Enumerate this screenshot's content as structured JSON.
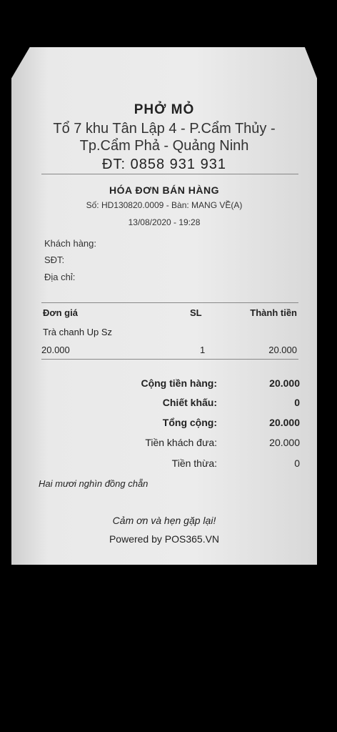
{
  "receipt": {
    "shop_name": "PHỞ MỎ",
    "address_line1": "Tổ 7 khu Tân Lập 4 - P.Cẩm Thủy -",
    "address_line2": "Tp.Cẩm Phả - Quảng Ninh",
    "phone": "ĐT: 0858 931 931",
    "invoice_title": "HÓA ĐƠN BÁN HÀNG",
    "invoice_number": "Số: HD130820.0009 - Bàn: MANG VỀ(A)",
    "invoice_datetime": "13/08/2020 - 19:28",
    "customer_label": "Khách hàng:",
    "phone_label": "SĐT:",
    "address_label": "Địa chỉ:",
    "columns": {
      "price": "Đơn giá",
      "qty": "SL",
      "total": "Thành tiền"
    },
    "items": [
      {
        "name": "Trà chanh Up Sz",
        "price": "20.000",
        "qty": "1",
        "total": "20.000"
      }
    ],
    "totals": {
      "subtotal_label": "Cộng tiền hàng:",
      "subtotal_value": "20.000",
      "discount_label": "Chiết khấu:",
      "discount_value": "0",
      "grand_label": "Tổng cộng:",
      "grand_value": "20.000",
      "paid_label": "Tiền khách đưa:",
      "paid_value": "20.000",
      "change_label": "Tiền thừa:",
      "change_value": "0"
    },
    "amount_in_words": "Hai mươi nghìn đồng chẵn",
    "thanks": "Cảm ơn và hẹn gặp lại!",
    "powered_by": "Powered by POS365.VN"
  }
}
